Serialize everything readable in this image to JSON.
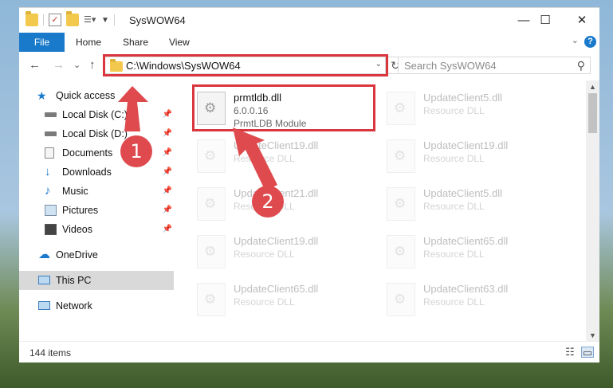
{
  "window": {
    "title": "SysWOW64",
    "minimize": "—",
    "maximize": "☐",
    "close": "✕"
  },
  "ribbon": {
    "file": "File",
    "tabs": [
      "Home",
      "Share",
      "View"
    ],
    "expand": "⌄",
    "help": "?"
  },
  "address": {
    "back": "←",
    "forward": "→",
    "recent": "⌄",
    "up": "↑",
    "path": "C:\\Windows\\SysWOW64",
    "dropdown": "⌄",
    "refresh": "↻",
    "search_placeholder": "Search SysWOW64",
    "search_icon": "⚲"
  },
  "sidebar": {
    "items": [
      {
        "label": "Quick access",
        "icon": "star-icon"
      },
      {
        "label": "Local Disk (C:)",
        "icon": "drive-icon"
      },
      {
        "label": "Local Disk (D:)",
        "icon": "drive-icon"
      },
      {
        "label": "Documents",
        "icon": "documents-icon"
      },
      {
        "label": "Downloads",
        "icon": "downloads-icon"
      },
      {
        "label": "Music",
        "icon": "music-icon"
      },
      {
        "label": "Pictures",
        "icon": "pictures-icon"
      },
      {
        "label": "Videos",
        "icon": "videos-icon"
      },
      {
        "label": "OneDrive",
        "icon": "onedrive-icon"
      },
      {
        "label": "This PC",
        "icon": "computer-icon"
      },
      {
        "label": "Network",
        "icon": "network-icon"
      }
    ],
    "pin": "📌"
  },
  "files": [
    {
      "name": "prmtldb.dll",
      "line2": "6.0.0.16",
      "line3": "PrmtLDB Module"
    },
    {
      "name": "UpdateClient5.dll",
      "line2": "Resource DLL"
    },
    {
      "name": "UpdateClient19.dll",
      "line2": "Resource DLL"
    },
    {
      "name": "UpdateClient19.dll",
      "line2": "Resource DLL"
    },
    {
      "name": "UpdateClient21.dll",
      "line2": "Resource DLL"
    },
    {
      "name": "UpdateClient5.dll",
      "line2": "Resource DLL"
    },
    {
      "name": "UpdateClient19.dll",
      "line2": "Resource DLL"
    },
    {
      "name": "UpdateClient65.dll",
      "line2": "Resource DLL"
    },
    {
      "name": "UpdateClient65.dll",
      "line2": "Resource DLL"
    },
    {
      "name": "UpdateClient63.dll",
      "line2": "Resource DLL"
    }
  ],
  "status": {
    "count": "144 items"
  },
  "annotations": {
    "step1": "1",
    "step2": "2",
    "color": "#de4a4e"
  }
}
